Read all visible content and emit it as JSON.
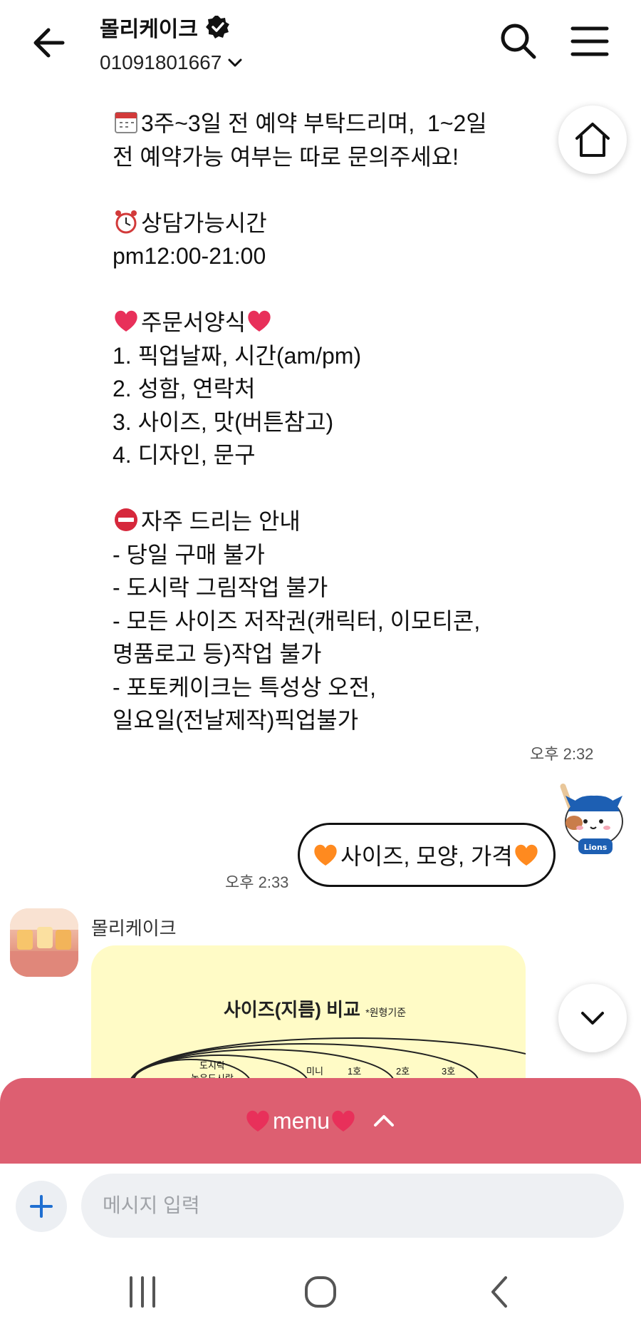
{
  "header": {
    "title": "몰리케이크",
    "phone": "01091801667"
  },
  "message": {
    "lines": [
      {
        "emoji": "calendar-icon",
        "text": "3주~3일 전 예약 부탁드리며,  1~2일"
      },
      {
        "emoji": "",
        "text": "전 예약가능 여부는 따로 문의주세요!"
      },
      {
        "emoji": "",
        "text": " "
      },
      {
        "emoji": "alarm-clock-icon",
        "text": "상담가능시간"
      },
      {
        "emoji": "",
        "text": "pm12:00-21:00"
      },
      {
        "emoji": "",
        "text": " "
      },
      {
        "emoji": "heart-icon",
        "text": "주문서양식",
        "trail": "heart-icon"
      },
      {
        "emoji": "",
        "text": "1. 픽업날짜, 시간(am/pm)"
      },
      {
        "emoji": "",
        "text": "2. 성함, 연락처"
      },
      {
        "emoji": "",
        "text": "3. 사이즈, 맛(버튼참고)"
      },
      {
        "emoji": "",
        "text": "4. 디자인, 문구"
      },
      {
        "emoji": "",
        "text": " "
      },
      {
        "emoji": "no-entry-icon",
        "text": "자주 드리는 안내"
      },
      {
        "emoji": "",
        "text": "- 당일 구매 불가"
      },
      {
        "emoji": "",
        "text": "- 도시락 그림작업 불가"
      },
      {
        "emoji": "",
        "text": "- 모든 사이즈 저작권(캐릭터, 이모티콘,"
      },
      {
        "emoji": "",
        "text": "명품로고 등)작업 불가"
      },
      {
        "emoji": "",
        "text": "- 포토케이크는 특성상 오전,"
      },
      {
        "emoji": "",
        "text": "일요일(전날제작)픽업불가"
      }
    ],
    "time": "오후 2:32"
  },
  "outgoing": {
    "text": "사이즈, 모양, 가격",
    "time": "오후 2:33"
  },
  "incoming": {
    "sender": "몰리케이크",
    "card_title": "사이즈(지름) 비교",
    "card_subtitle": "*원형기준",
    "card_labels": [
      "도시락",
      "높은도시락",
      "미니",
      "1호",
      "2호",
      "3호"
    ]
  },
  "menu_bar": {
    "label": "menu"
  },
  "input": {
    "placeholder": "메시지 입력"
  },
  "colors": {
    "menu_bar": "#dd5f71",
    "card_bg": "#fffbc6",
    "heart": "#e8305a",
    "orange_heart": "#ff8a1f"
  }
}
